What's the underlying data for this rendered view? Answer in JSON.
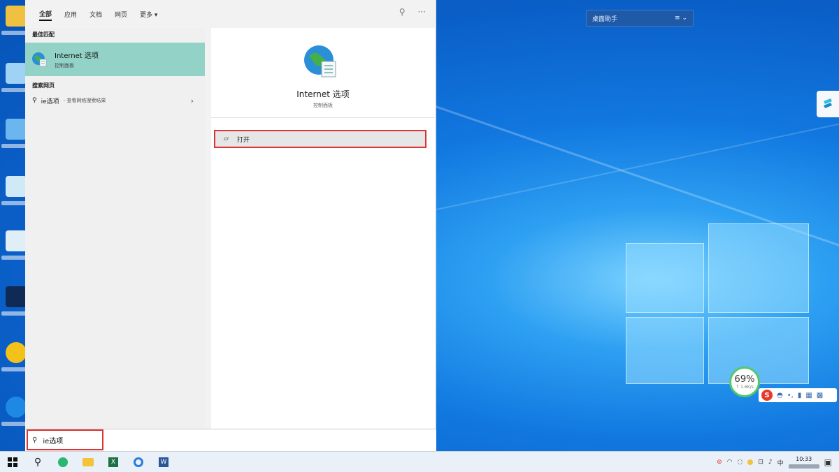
{
  "tabs": [
    {
      "label": "全部",
      "active": true
    },
    {
      "label": "应用"
    },
    {
      "label": "文档"
    },
    {
      "label": "网页"
    },
    {
      "label": "更多 ▾"
    }
  ],
  "left": {
    "best_match_title": "最佳匹配",
    "best_item": {
      "name": "Internet 选项",
      "sub": "控制面板"
    },
    "web_title": "搜索网页",
    "web_item": {
      "query": "ie选项",
      "sub": "- 查看网络搜索结果"
    }
  },
  "detail": {
    "title": "Internet 选项",
    "sub": "控制面板",
    "open_label": "打开"
  },
  "search": {
    "value": "ie选项"
  },
  "widget": {
    "label": "桌面助手"
  },
  "meter": {
    "percent": "69%",
    "speed": "↑ 1.6K/s"
  },
  "clock": {
    "time": "10:33"
  },
  "colors": {
    "best_match_bg": "#93d2c6",
    "highlight_red": "#dd3333",
    "desktop_blue": "#0a62c9"
  },
  "icons": [
    "globe-icon",
    "search-icon",
    "windows-start-icon",
    "file-explorer-icon",
    "excel-icon",
    "word-icon",
    "open-icon",
    "pin-icon",
    "more-icon",
    "chevron-right-icon"
  ]
}
